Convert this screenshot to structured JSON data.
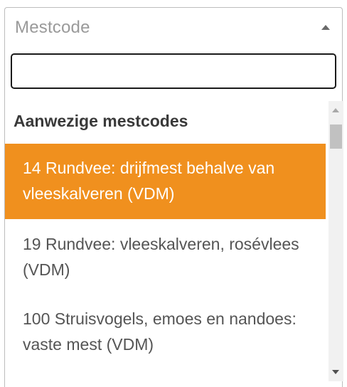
{
  "select": {
    "placeholder": "Mestcode",
    "arrow_icon": "triangle-up-icon"
  },
  "search": {
    "value": "",
    "placeholder": ""
  },
  "dropdown": {
    "group_label": "Aanwezige mestcodes",
    "options": [
      {
        "label": "14 Rundvee: drijfmest behalve van vleeskalveren (VDM)",
        "highlighted": true
      },
      {
        "label": "19 Rundvee: vleeskalveren, rosévlees (VDM)",
        "highlighted": false
      },
      {
        "label": "100 Struisvogels, emoes en nandoes: vaste mest (VDM)",
        "highlighted": false
      }
    ],
    "highlight_color": "#f0901e"
  },
  "scrollbar": {
    "up_icon": "scroll-up-arrow-icon",
    "down_icon": "scroll-down-arrow-icon"
  }
}
